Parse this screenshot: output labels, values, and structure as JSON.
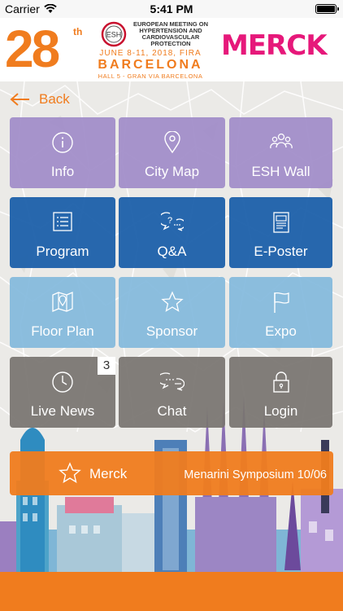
{
  "statusbar": {
    "carrier": "Carrier",
    "time": "5:41 PM"
  },
  "banner": {
    "edition": "28",
    "edition_suffix": "th",
    "logo_text": "ESH",
    "meeting": "EUROPEAN MEETING ON HYPERTENSION AND CARDIOVASCULAR PROTECTION",
    "dates": "JUNE 8-11, 2018, FIRA",
    "city": "BARCELONA",
    "venue": "HALL 5 - GRAN VIA BARCELONA",
    "sponsor_logo": "MERCK"
  },
  "nav": {
    "back_label": "Back"
  },
  "tiles": [
    {
      "label": "Info",
      "icon": "info-icon"
    },
    {
      "label": "City Map",
      "icon": "map-pin-icon"
    },
    {
      "label": "ESH Wall",
      "icon": "people-icon"
    },
    {
      "label": "Program",
      "icon": "list-icon"
    },
    {
      "label": "Q&A",
      "icon": "chat-question-icon"
    },
    {
      "label": "E-Poster",
      "icon": "poster-icon"
    },
    {
      "label": "Floor Plan",
      "icon": "floor-plan-icon"
    },
    {
      "label": "Sponsor",
      "icon": "star-icon"
    },
    {
      "label": "Expo",
      "icon": "flag-icon"
    },
    {
      "label": "Live News",
      "icon": "clock-icon",
      "badge": "3"
    },
    {
      "label": "Chat",
      "icon": "chat-bubbles-icon"
    },
    {
      "label": "Login",
      "icon": "lock-icon"
    }
  ],
  "sponsor_bar": {
    "name": "Merck",
    "event": "Menarini Symposium 10/06"
  },
  "colors": {
    "accent": "#f07c1e",
    "purple": "#a08cc8",
    "blue": "#1c60aa",
    "light_blue": "#82b9dc",
    "gray": "#787470",
    "merck": "#e6187a"
  }
}
